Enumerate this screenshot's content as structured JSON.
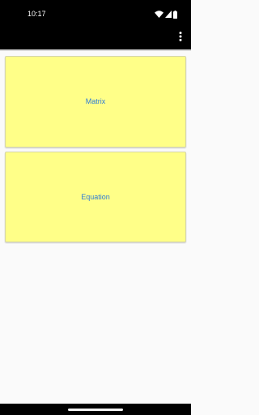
{
  "status_bar": {
    "time": "10:17",
    "icons": [
      "wifi-icon",
      "cellular-signal-icon",
      "battery-icon"
    ]
  },
  "app_bar": {
    "overflow_icon": "more-vert-icon"
  },
  "cards": [
    {
      "label": "Matrix"
    },
    {
      "label": "Equation"
    }
  ],
  "colors": {
    "card_background": "#ffff88",
    "card_label": "#2e7bd6",
    "app_bar": "#000000",
    "content_background": "#fafafa"
  }
}
